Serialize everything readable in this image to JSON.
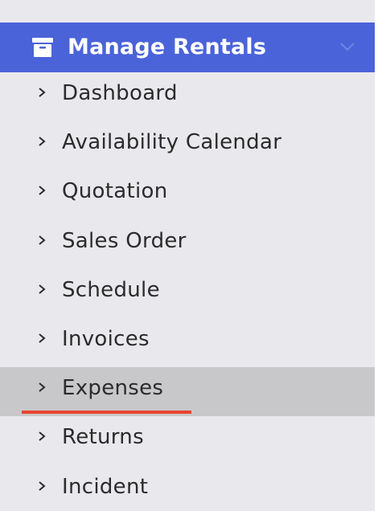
{
  "section": {
    "title": "Manage Rentals",
    "icon": "archive-box-icon",
    "toggle_icon": "chevron-down-icon",
    "header_color": "#4a63d8"
  },
  "menu": {
    "items": [
      {
        "label": "Dashboard"
      },
      {
        "label": "Availability Calendar"
      },
      {
        "label": "Quotation"
      },
      {
        "label": "Sales Order"
      },
      {
        "label": "Schedule"
      },
      {
        "label": "Invoices"
      },
      {
        "label": "Expenses",
        "active": true
      },
      {
        "label": "Returns"
      },
      {
        "label": "Incident"
      }
    ],
    "active_item": "Expenses",
    "active_bg": "#c8c8ca",
    "highlight_underline_color": "#e8432f"
  }
}
